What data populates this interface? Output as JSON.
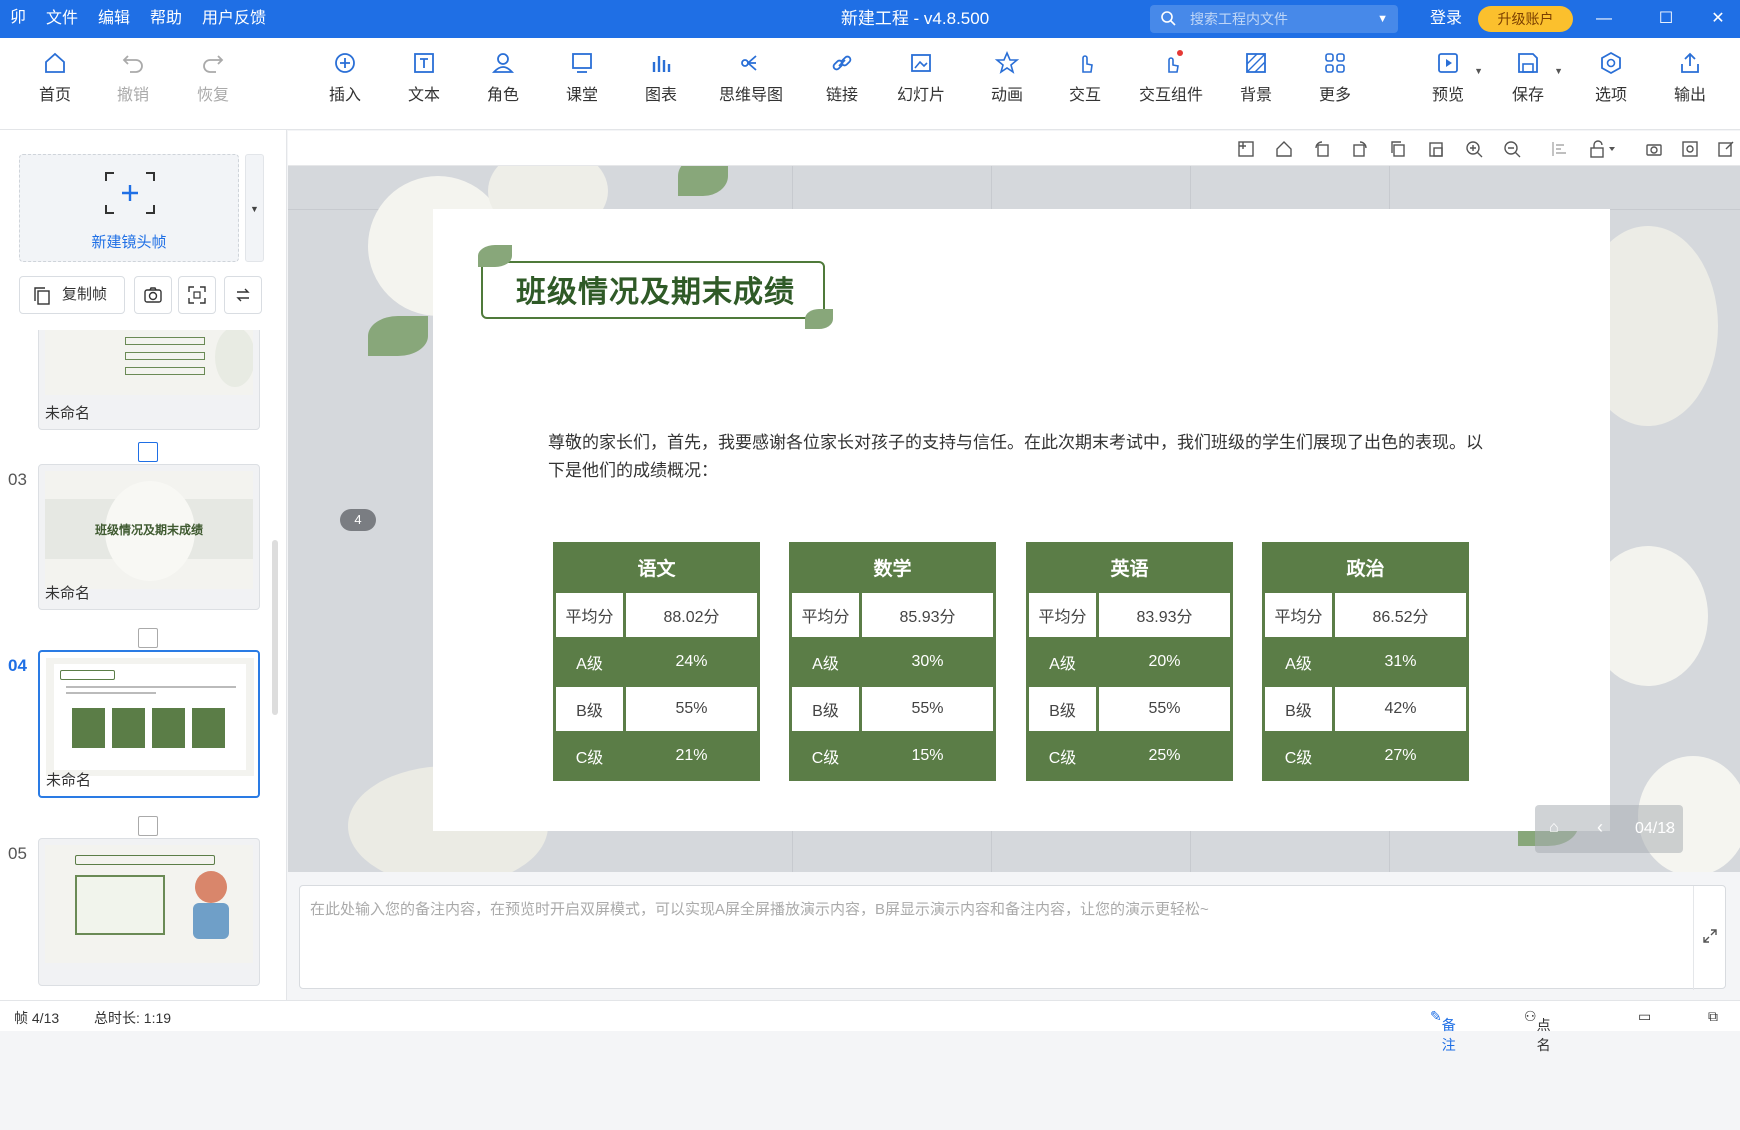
{
  "app": {
    "logo": "卯",
    "menu": [
      "文件",
      "编辑",
      "帮助",
      "用户反馈"
    ],
    "window_title": "新建工程 - v4.8.500",
    "search_placeholder": "搜索工程内文件",
    "login": "登录",
    "upgrade": "升级账户"
  },
  "toolbar": [
    {
      "label": "首页",
      "icon": "home-icon"
    },
    {
      "label": "撤销",
      "icon": "undo-icon",
      "disabled": true
    },
    {
      "label": "恢复",
      "icon": "redo-icon",
      "disabled": true
    },
    {
      "label": "插入",
      "icon": "insert-icon"
    },
    {
      "label": "文本",
      "icon": "text-icon"
    },
    {
      "label": "角色",
      "icon": "role-icon"
    },
    {
      "label": "课堂",
      "icon": "classroom-icon"
    },
    {
      "label": "图表",
      "icon": "chart-icon"
    },
    {
      "label": "思维导图",
      "icon": "mindmap-icon"
    },
    {
      "label": "链接",
      "icon": "link-icon"
    },
    {
      "label": "幻灯片",
      "icon": "slides-icon"
    },
    {
      "label": "动画",
      "icon": "animation-icon"
    },
    {
      "label": "交互",
      "icon": "interact-icon"
    },
    {
      "label": "交互组件",
      "icon": "interact-component-icon"
    },
    {
      "label": "背景",
      "icon": "background-icon"
    },
    {
      "label": "更多",
      "icon": "more-icon"
    },
    {
      "label": "预览",
      "icon": "preview-icon"
    },
    {
      "label": "保存",
      "icon": "save-icon"
    },
    {
      "label": "选项",
      "icon": "options-icon"
    },
    {
      "label": "输出",
      "icon": "export-icon"
    }
  ],
  "left_panel": {
    "new_frame": "新建镜头帧",
    "copy_frame": "复制帧",
    "slides": [
      {
        "num": "",
        "name": "未命名"
      },
      {
        "num": "03",
        "name": "未命名",
        "thumb_title": "班级情况及期末成绩"
      },
      {
        "num": "04",
        "name": "未命名",
        "active": true
      },
      {
        "num": "05",
        "name": ""
      }
    ]
  },
  "slide": {
    "title": "班级情况及期末成绩",
    "paragraph": "尊敬的家长们，首先，我要感谢各位家长对孩子的支持与信任。在此次期末考试中，我们班级的学生们展现了出色的表现。以下是他们的成绩概况：",
    "page_badge": "4",
    "subjects": [
      {
        "name": "语文",
        "rows": [
          [
            "平均分",
            "88.02分"
          ],
          [
            "A级",
            "24%"
          ],
          [
            "B级",
            "55%"
          ],
          [
            "C级",
            "21%"
          ]
        ]
      },
      {
        "name": "数学",
        "rows": [
          [
            "平均分",
            "85.93分"
          ],
          [
            "A级",
            "30%"
          ],
          [
            "B级",
            "55%"
          ],
          [
            "C级",
            "15%"
          ]
        ]
      },
      {
        "name": "英语",
        "rows": [
          [
            "平均分",
            "83.93分"
          ],
          [
            "A级",
            "20%"
          ],
          [
            "B级",
            "55%"
          ],
          [
            "C级",
            "25%"
          ]
        ]
      },
      {
        "name": "政治",
        "rows": [
          [
            "平均分",
            "86.52分"
          ],
          [
            "A级",
            "31%"
          ],
          [
            "B级",
            "42%"
          ],
          [
            "C级",
            "27%"
          ]
        ]
      }
    ]
  },
  "nav": {
    "page": "04/13"
  },
  "notes": {
    "placeholder": "在此处输入您的备注内容，在预览时开启双屏模式，可以实现A屏全屏播放演示内容，B屏显示演示内容和备注内容，让您的演示更轻松~"
  },
  "status": {
    "frame": "帧 4/13",
    "duration": "总时长: 1:19",
    "notes_btn": "备注",
    "rollcall_btn": "点名"
  },
  "colors": {
    "accent": "#1f6fe5",
    "table_green": "#5b7d47",
    "upgrade": "#fbc02d"
  }
}
